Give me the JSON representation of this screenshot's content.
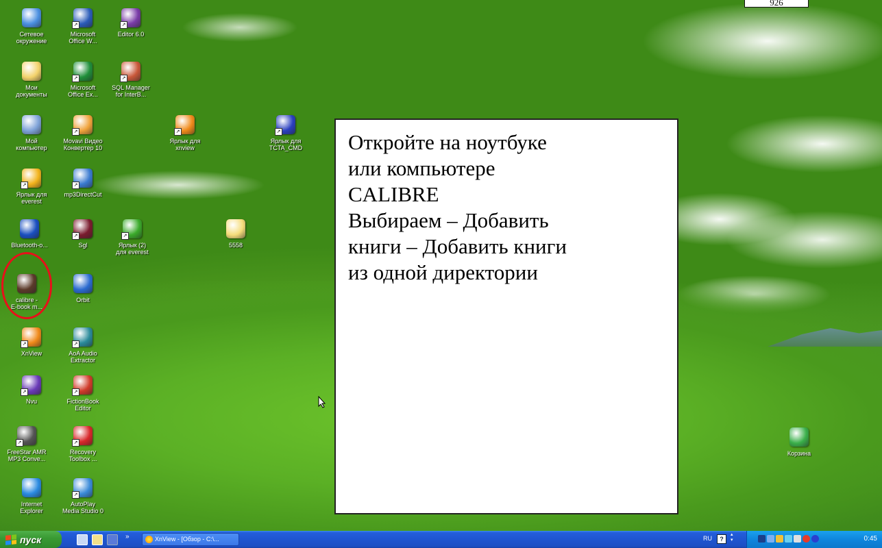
{
  "page_number": "926",
  "desktop_icons": [
    {
      "id": "network",
      "label": "Сетевое\nокружение",
      "shortcut": false,
      "color": "#4a8fe0"
    },
    {
      "id": "word",
      "label": "Microsoft\nOffice W...",
      "shortcut": true,
      "color": "#2a5bb8"
    },
    {
      "id": "editor",
      "label": "Editor 6.0",
      "shortcut": true,
      "color": "#7a3ca8"
    },
    {
      "id": "mydocs",
      "label": "Мои\nдокументы",
      "shortcut": false,
      "color": "#f3d26b"
    },
    {
      "id": "excel",
      "label": "Microsoft\nOffice Ex...",
      "shortcut": true,
      "color": "#1f8f3a"
    },
    {
      "id": "sqlmanager",
      "label": "SQL Manager\nfor InterB...",
      "shortcut": true,
      "color": "#c9583a"
    },
    {
      "id": "mycomputer",
      "label": "Мой\nкомпьютер",
      "shortcut": false,
      "color": "#7ea2d8"
    },
    {
      "id": "movavi",
      "label": "Movavi Видео\nКонвертер 10",
      "shortcut": true,
      "color": "#f0a23a"
    },
    {
      "id": "xnview-shortcut",
      "label": "Ярлык для\nxnview",
      "shortcut": true,
      "color": "#f08a1a"
    },
    {
      "id": "tcta",
      "label": "Ярлык для\nTCTA_CMD",
      "shortcut": true,
      "color": "#2a3fbf"
    },
    {
      "id": "everest",
      "label": "Ярлык для\neverest",
      "shortcut": true,
      "color": "#f2b31c"
    },
    {
      "id": "mp3directcut",
      "label": "mp3DirectCut",
      "shortcut": true,
      "color": "#3a7ad0"
    },
    {
      "id": "bluetooth",
      "label": "Bluetooth-о...",
      "shortcut": false,
      "color": "#1a4fc0"
    },
    {
      "id": "sgl",
      "label": "Sgl",
      "shortcut": true,
      "color": "#7a1b2e"
    },
    {
      "id": "everest2",
      "label": "Ярлык (2)\nдля everest",
      "shortcut": true,
      "color": "#3aaa2a"
    },
    {
      "id": "folder5558",
      "label": "5558",
      "shortcut": false,
      "color": "#f5dc7a"
    },
    {
      "id": "calibre",
      "label": "calibre -\nE-book m...",
      "shortcut": false,
      "color": "#5b3a2a"
    },
    {
      "id": "orbit",
      "label": "Orbit",
      "shortcut": false,
      "color": "#2a6ad0"
    },
    {
      "id": "xnview",
      "label": "XnView",
      "shortcut": true,
      "color": "#f08a1a"
    },
    {
      "id": "aoa",
      "label": "AoA Audio\nExtractor",
      "shortcut": true,
      "color": "#2a8a9a"
    },
    {
      "id": "nvu",
      "label": "Nvu",
      "shortcut": true,
      "color": "#6a3ab8"
    },
    {
      "id": "fictionbook",
      "label": "FictionBook\nEditor",
      "shortcut": true,
      "color": "#d03a2a"
    },
    {
      "id": "freestar",
      "label": "FreeStar AMR\nMP3 Conve...",
      "shortcut": true,
      "color": "#555555"
    },
    {
      "id": "recovery",
      "label": "Recovery\nToolbox ...",
      "shortcut": true,
      "color": "#d8262a"
    },
    {
      "id": "ie",
      "label": "Internet\nExplorer",
      "shortcut": false,
      "color": "#2a8ae0"
    },
    {
      "id": "autoplay",
      "label": "AutoPlay\nMedia Studio 0",
      "shortcut": true,
      "color": "#3a8ad8"
    },
    {
      "id": "recycle",
      "label": "Корзина",
      "shortcut": false,
      "color": "#3ab04a"
    }
  ],
  "info_box": {
    "lines": [
      "Откройте на ноутбуке",
      "или компьютере",
      "CALIBRE",
      "Выбираем – Добавить",
      "книги – Добавить книги",
      "из одной директории"
    ]
  },
  "taskbar": {
    "start_label": "пуск",
    "chevron": "»",
    "task_label": "XnView - [Обзор - C:\\...",
    "lang": "RU",
    "lang_icon": "?",
    "clock": "0:45"
  },
  "colors": {
    "highlight": "#e8101a",
    "taskbar": "#245edb",
    "start": "#3a9b34",
    "tray": "#0f86dd"
  }
}
